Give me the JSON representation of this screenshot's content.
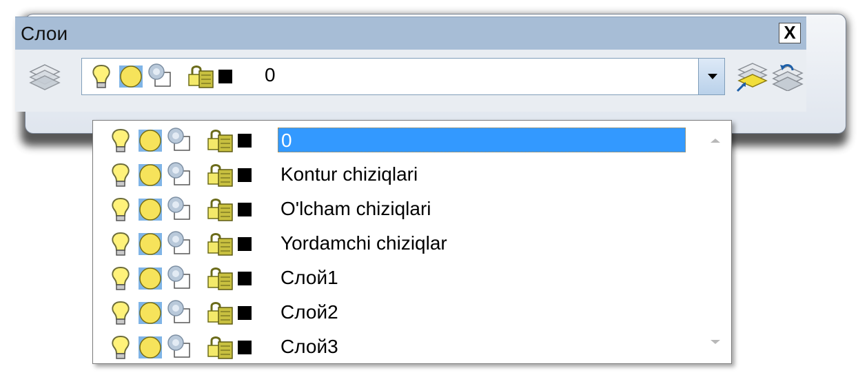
{
  "window": {
    "title": "Слои",
    "close_label": "X"
  },
  "combo": {
    "current_value": "0",
    "color_swatch": "#000000"
  },
  "dropdown": {
    "items": [
      {
        "label": "0",
        "selected": true
      },
      {
        "label": "Kontur chiziqlari",
        "selected": false
      },
      {
        "label": "O'lcham chiziqlari",
        "selected": false
      },
      {
        "label": "Yordamchi chiziqlar",
        "selected": false
      },
      {
        "label": "Слой1",
        "selected": false
      },
      {
        "label": "Слой2",
        "selected": false
      },
      {
        "label": "Слой3",
        "selected": false
      }
    ]
  },
  "icons": {
    "layer_manager": "layers-stack-icon",
    "on_off": "lightbulb-icon",
    "freeze": "sun-icon",
    "vp_freeze": "viewport-freeze-icon",
    "lock": "padlock-icon",
    "color": "color-swatch-icon",
    "make_current": "make-object-layer-current-icon",
    "previous": "layer-previous-icon"
  },
  "colors": {
    "titlebar": "#a7bdd6",
    "selection": "#3399ff",
    "bulb": "#fff27a",
    "sun": "#f6e35b"
  }
}
